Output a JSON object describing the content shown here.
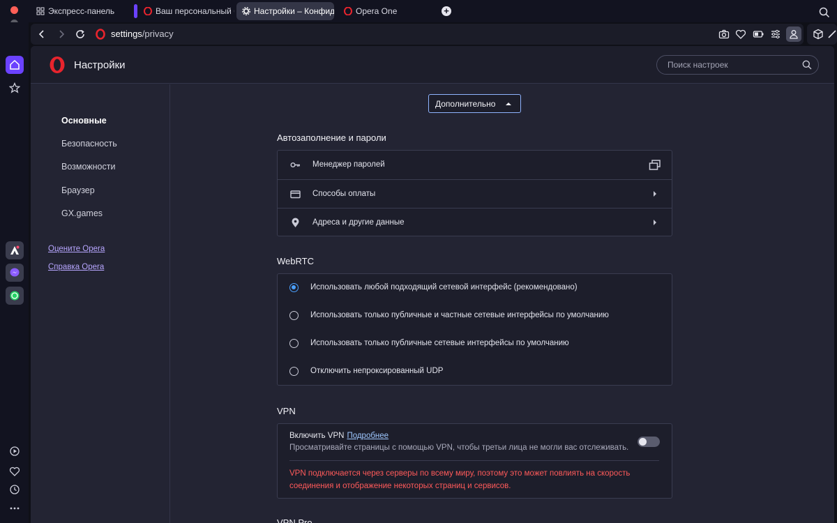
{
  "browser": {
    "tabs": [
      {
        "label": "Экспресс-панель",
        "icon": "speed-dial-icon"
      },
      {
        "label": "Ваш персональный бра",
        "icon": "opera-icon"
      },
      {
        "label": "Настройки – Конфиден",
        "icon": "gear-icon",
        "active": true
      },
      {
        "label": "Opera One",
        "icon": "opera-icon"
      }
    ],
    "url_host": "settings",
    "url_path": "/privacy"
  },
  "app": {
    "title": "Настройки",
    "search_placeholder": "Поиск настроек",
    "nav": [
      {
        "label": "Основные",
        "current": true
      },
      {
        "label": "Безопасность"
      },
      {
        "label": "Возможности"
      },
      {
        "label": "Браузер"
      },
      {
        "label": "GX.games"
      }
    ],
    "links": [
      "Оцените Opera",
      "Справка Opera"
    ],
    "advanced_dropdown": "Дополнительно"
  },
  "autofill": {
    "title": "Автозаполнение и пароли",
    "rows": [
      {
        "label": "Менеджер паролей",
        "icon": "key-icon",
        "action": "external"
      },
      {
        "label": "Способы оплаты",
        "icon": "credit-card-icon",
        "action": "arrow"
      },
      {
        "label": "Адреса и другие данные",
        "icon": "location-pin-icon",
        "action": "arrow"
      }
    ]
  },
  "webrtc": {
    "title": "WebRTC",
    "options": [
      {
        "label": "Использовать любой подходящий сетевой интерфейс (рекомендовано)",
        "checked": true
      },
      {
        "label": "Использовать только публичные и частные сетевые интерфейсы по умолчанию",
        "checked": false
      },
      {
        "label": "Использовать только публичные сетевые интерфейсы по умолчанию",
        "checked": false
      },
      {
        "label": "Отключить непроксированный UDP",
        "checked": false
      }
    ]
  },
  "vpn": {
    "title": "VPN",
    "enable_label": "Включить VPN",
    "more_link": "Подробнее",
    "description": "Просматривайте страницы с помощью VPN, чтобы третьи лица не могли вас отслеживать.",
    "enabled": false,
    "warning": "VPN подключается через серверы по всему миру, поэтому это может повлиять на скорость соединения и отображение некоторых страниц и сервисов."
  },
  "vpn_pro": {
    "title": "VPN Pro"
  },
  "colors": {
    "accent": "#6b42ff",
    "radio_selected": "#4aa0ff",
    "warning": "#ff5a5a",
    "opera_red": "#e8242d"
  }
}
